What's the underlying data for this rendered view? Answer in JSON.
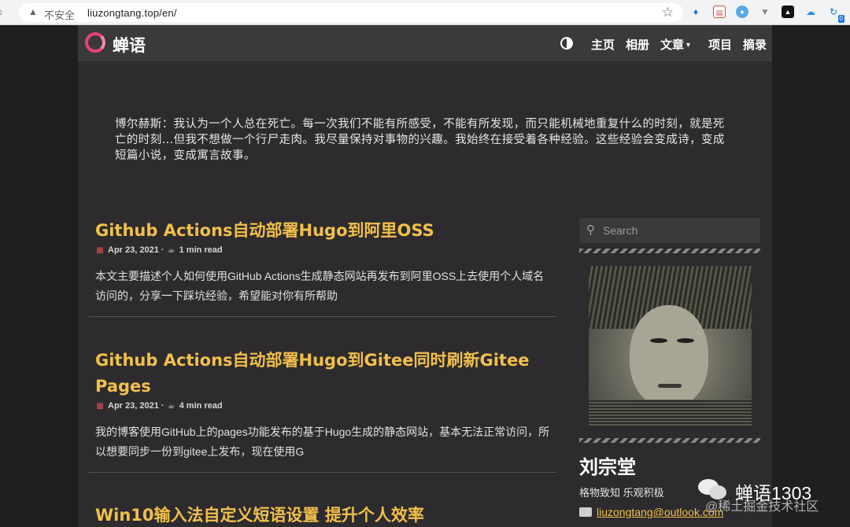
{
  "browser": {
    "security_label": "不安全",
    "url": "liuzongtang.top/en/",
    "extension_badge": "0"
  },
  "site": {
    "brand": "蝉语",
    "nav": [
      {
        "label": "主页"
      },
      {
        "label": "相册"
      },
      {
        "label": "文章"
      },
      {
        "label": "项目"
      },
      {
        "label": "摘录"
      }
    ],
    "quote": "博尔赫斯：我认为一个人总在死亡。每一次我们不能有所感受，不能有所发现，而只能机械地重复什么的时刻，就是死亡的时刻…但我不想做一个行尸走肉。我尽量保持对事物的兴趣。我始终在接受着各种经验。这些经验会变成诗，变成短篇小说，变成寓言故事。"
  },
  "posts": [
    {
      "title": "Github Actions自动部署Hugo到阿里OSS",
      "date": "Apr 23, 2021",
      "read_time": "1 min read",
      "summary": "本文主要描述个人如何使用GitHub Actions生成静态网站再发布到阿里OSS上去使用个人域名访问的，分享一下踩坑经验，希望能对你有所帮助"
    },
    {
      "title": "Github Actions自动部署Hugo到Gitee同时刷新Gitee Pages",
      "date": "Apr 23, 2021",
      "read_time": "4 min read",
      "summary": "我的博客使用GitHub上的pages功能发布的基于Hugo生成的静态网站，基本无法正常访问，所以想要同步一份到gitee上发布，现在使用G"
    },
    {
      "title": "Win10输入法自定义短语设置 提升个人效率"
    }
  ],
  "sidebar": {
    "search_placeholder": "Search",
    "author_name": "刘宗堂",
    "motto": "格物致知 乐观积极",
    "email": "liuzongtang@outlook.com"
  },
  "watermark": {
    "name": "蝉语1303",
    "sub": "@稀土掘金技术社区"
  },
  "colors": {
    "accent": "#f1c04a",
    "brand": "#e9426f",
    "background": "#2d2b2e"
  }
}
